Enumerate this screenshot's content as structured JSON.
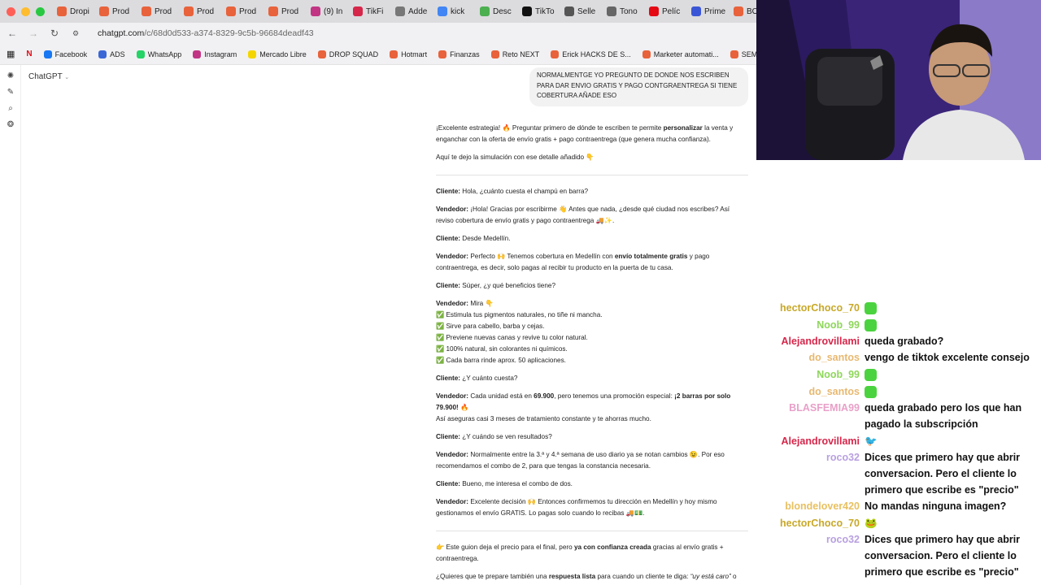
{
  "tabs": [
    {
      "label": "Dropi",
      "color": "#e8623b"
    },
    {
      "label": "Prod",
      "color": "#e8623b"
    },
    {
      "label": "Prod",
      "color": "#e8623b"
    },
    {
      "label": "Prod",
      "color": "#e8623b"
    },
    {
      "label": "Prod",
      "color": "#e8623b"
    },
    {
      "label": "Prod",
      "color": "#e8623b"
    },
    {
      "label": "(9) In",
      "color": "#c13584"
    },
    {
      "label": "TikFi",
      "color": "#d6264a"
    },
    {
      "label": "Adde",
      "color": "#777777"
    },
    {
      "label": "kick",
      "color": "#4285f4"
    },
    {
      "label": "Desc",
      "color": "#4caf50"
    },
    {
      "label": "TikTo",
      "color": "#111111"
    },
    {
      "label": "Selle",
      "color": "#555555"
    },
    {
      "label": "Tono",
      "color": "#666666"
    },
    {
      "label": "Pelíc",
      "color": "#e50914"
    },
    {
      "label": "Prime",
      "color": "#3a56d6"
    },
    {
      "label": "BOR",
      "color": "#e8623b"
    }
  ],
  "address": {
    "domain": "chatgpt.com",
    "path": "/c/68d0d533-a374-8329-9c5b-96684deadf43"
  },
  "bookmarks": [
    {
      "label": "Facebook",
      "color": "#1877f2"
    },
    {
      "label": "ADS",
      "color": "#3b66d6"
    },
    {
      "label": "WhatsApp",
      "color": "#25d366"
    },
    {
      "label": "Instagram",
      "color": "#c13584"
    },
    {
      "label": "Mercado Libre",
      "color": "#f5d500"
    },
    {
      "label": "DROP SQUAD",
      "color": "#e8623b"
    },
    {
      "label": "Hotmart",
      "color": "#e8623b"
    },
    {
      "label": "Finanzas",
      "color": "#e8623b"
    },
    {
      "label": "Reto NEXT",
      "color": "#e8623b"
    },
    {
      "label": "Erick HACKS DE S...",
      "color": "#e8623b"
    },
    {
      "label": "Marketer automati...",
      "color": "#e8623b"
    },
    {
      "label": "SEMINARIOS ONLI...",
      "color": "#e8623b"
    }
  ],
  "app": {
    "model_label": "ChatGPT"
  },
  "user_message": "NORMALMENTGE YO PREGUNTO DE DONDE NOS ESCRIBEN PARA DAR ENVIO GRATIS Y PAGO CONTGRAENTREGA SI TIENE COBERTURA AÑADE ESO",
  "reply": {
    "intro1_a": "¡Excelente estrategia! 🔥 Preguntar primero de dónde te escriben te permite ",
    "intro1_b": "personalizar",
    "intro1_c": " la venta y enganchar con la oferta de envío gratis + pago contraentrega (que genera mucha confianza).",
    "intro2": "Aquí te dejo la simulación con ese detalle añadido 👇",
    "cliente": "Cliente:",
    "vendedor": "Vendedor:",
    "l1": " Hola, ¿cuánto cuesta el champú en barra?",
    "l2": " ¡Hola! Gracias por escribirme 👋 Antes que nada, ¿desde qué ciudad nos escribes? Así reviso cobertura de envío gratis y pago contraentrega 🚚✨.",
    "l3": " Desde Medellín.",
    "l4_a": " Perfecto 🙌 Tenemos cobertura en Medellín con ",
    "l4_b": "envío totalmente gratis",
    "l4_c": " y pago contraentrega, es decir, solo pagas al recibir tu producto en la puerta de tu casa.",
    "l5": " Súper, ¿y qué beneficios tiene?",
    "l6": " Mira 👇",
    "benefits": [
      "✅ Estimula tus pigmentos naturales, no tiñe ni mancha.",
      "✅ Sirve para cabello, barba y cejas.",
      "✅ Previene nuevas canas y revive tu color natural.",
      "✅ 100% natural, sin colorantes ni químicos.",
      "✅ Cada barra rinde aprox. 50 aplicaciones."
    ],
    "l7": " ¿Y cuánto cuesta?",
    "l8_a": " Cada unidad está en ",
    "l8_b": "69.900",
    "l8_c": ", pero tenemos una promoción especial: ",
    "l8_d": "¡2 barras por solo 79.900!",
    "l8_e": " 🔥",
    "l8_f": "Así aseguras casi 3 meses de tratamiento constante y te ahorras mucho.",
    "l9": " ¿Y cuándo se ven resultados?",
    "l10": " Normalmente entre la 3.ª y 4.ª semana de uso diario ya se notan cambios 😉. Por eso recomendamos el combo de 2, para que tengas la constancia necesaria.",
    "l11": " Bueno, me interesa el combo de dos.",
    "l12": " Excelente decisión 🙌 Entonces confirmemos tu dirección en Medellín y hoy mismo gestionamos el envío GRATIS. Lo pagas solo cuando lo recibas 🚚💵.",
    "outro1_a": "👉 Este guion deja el precio para el final, pero ",
    "outro1_b": "ya con confianza creada",
    "outro1_c": " gracias al envío gratis + contraentrega.",
    "outro2_a": "¿Quieres que te prepare también una ",
    "outro2_b": "respuesta lista",
    "outro2_c": " para cuando un cliente te diga: ",
    "outro2_d": "“uy está caro”",
    "outro2_e": " o"
  },
  "stream_chat": [
    {
      "user": "hectorChoco_70",
      "color": "#c8a828",
      "text": "",
      "emoji": true
    },
    {
      "user": "Noob_99",
      "color": "#8ed65a",
      "text": "",
      "emoji": true
    },
    {
      "user": "Alejandrovillami",
      "color": "#d6264a",
      "text": "queda grabado?",
      "emoji": false
    },
    {
      "user": "do_santos",
      "color": "#e8b870",
      "text": "vengo de tiktok excelente consejo",
      "emoji": false
    },
    {
      "user": "Noob_99",
      "color": "#8ed65a",
      "text": "",
      "emoji": true
    },
    {
      "user": "do_santos",
      "color": "#e8b870",
      "text": "",
      "emoji": true
    },
    {
      "user": "BLASFEMIA99",
      "color": "#e8a0c8",
      "text": "queda grabado pero los que han pagado la subscripción",
      "emoji": false
    },
    {
      "user": "Alejandrovillami",
      "color": "#d6264a",
      "text": "🐦",
      "emoji": false
    },
    {
      "user": "roco32",
      "color": "#b8a0e0",
      "text": "Dices que primero hay que abrir conversacion. Pero el cliente lo primero que escribe es \"precio\"",
      "emoji": false
    },
    {
      "user": "blondelover420",
      "color": "#e8c060",
      "text": "No mandas ninguna imagen?",
      "emoji": false
    },
    {
      "user": "hectorChoco_70",
      "color": "#c8a828",
      "text": "🐸",
      "emoji": false
    },
    {
      "user": "roco32",
      "color": "#b8a0e0",
      "text": "Dices que primero hay que abrir conversacion. Pero el cliente lo primero que escribe es \"precio\"",
      "emoji": false
    }
  ],
  "colors": {
    "accent": "#10a37f",
    "bubble": "#f2f2f2"
  }
}
